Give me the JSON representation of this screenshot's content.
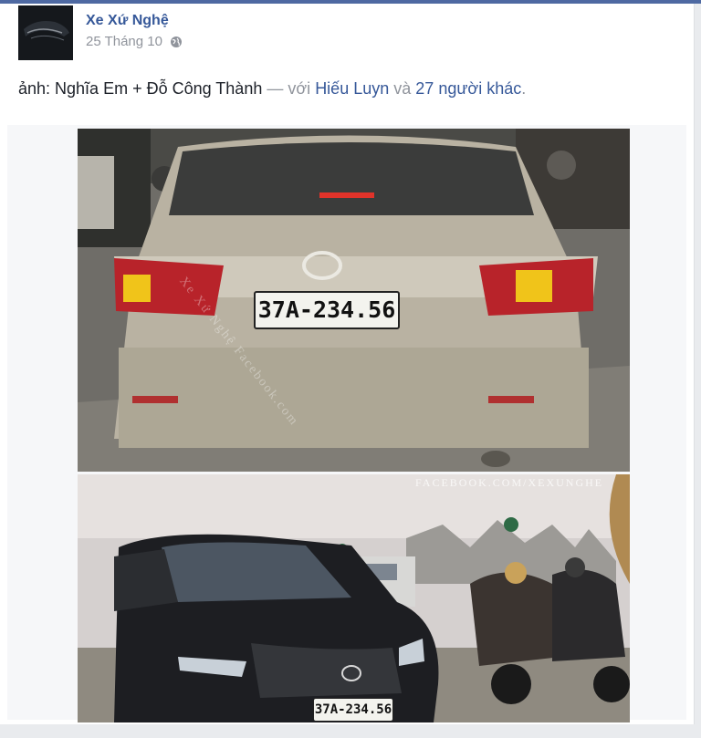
{
  "post": {
    "author": "Xe Xứ Nghệ",
    "date": "25 Tháng 10",
    "privacy_icon": "globe-icon",
    "caption": {
      "prefix": "ảnh: Nghĩa Em + Đỗ Công Thành",
      "separator": "— với",
      "tagged": "Hiếu Luyn",
      "conj": "và",
      "others": "27 người khác",
      "end": "."
    }
  },
  "photos": [
    {
      "plate": "37A-234.56",
      "watermark": "Xe Xứ Nghệ Facebook.com"
    },
    {
      "plate": "37A-234.56",
      "watermark": "FACEBOOK.COM/XEXUNGHE"
    }
  ],
  "colors": {
    "link": "#365899",
    "header_bar": "#4e69a2",
    "muted": "#90949c"
  }
}
